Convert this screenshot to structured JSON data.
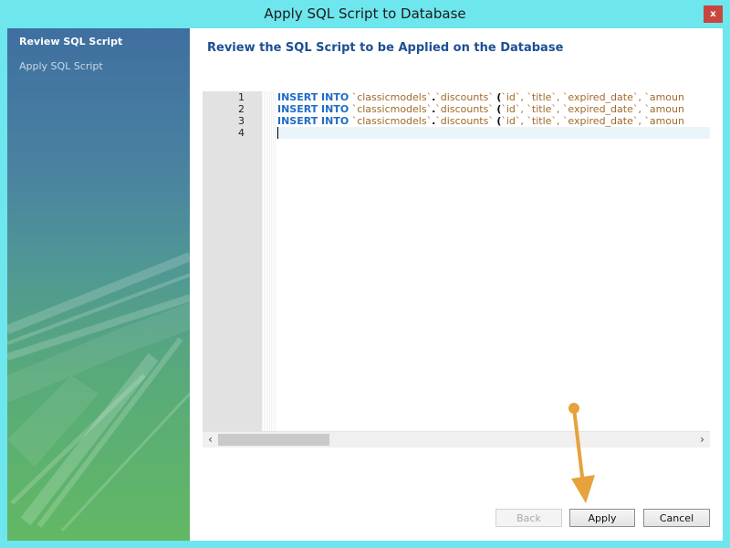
{
  "window": {
    "title": "Apply SQL Script to Database",
    "close_label": "x"
  },
  "sidebar": {
    "steps": [
      {
        "label": "Review SQL Script",
        "active": true
      },
      {
        "label": "Apply SQL Script",
        "active": false
      }
    ]
  },
  "main": {
    "heading": "Review the SQL Script to be Applied on the Database"
  },
  "editor": {
    "line_numbers": [
      "1",
      "2",
      "3",
      "4"
    ],
    "lines": [
      {
        "kw": "INSERT INTO",
        "schema": "`classicmodels`",
        "dot": ".",
        "table": "`discounts`",
        "paren": "(",
        "cols": "`id`, `title`, `expired_date`, `amoun"
      },
      {
        "kw": "INSERT INTO",
        "schema": "`classicmodels`",
        "dot": ".",
        "table": "`discounts`",
        "paren": "(",
        "cols": "`id`, `title`, `expired_date`, `amoun"
      },
      {
        "kw": "INSERT INTO",
        "schema": "`classicmodels`",
        "dot": ".",
        "table": "`discounts`",
        "paren": "(",
        "cols": "`id`, `title`, `expired_date`, `amoun"
      }
    ],
    "scroll_left_icon": "‹",
    "scroll_right_icon": "›"
  },
  "buttons": {
    "back": "Back",
    "apply": "Apply",
    "cancel": "Cancel"
  },
  "colors": {
    "accent_heading": "#1d4f93",
    "keyword": "#1e6cc4",
    "identifier": "#a06a28",
    "annotation_arrow": "#e6a23c",
    "titlebar": "#6ee6ee",
    "close_button": "#c8463f"
  }
}
